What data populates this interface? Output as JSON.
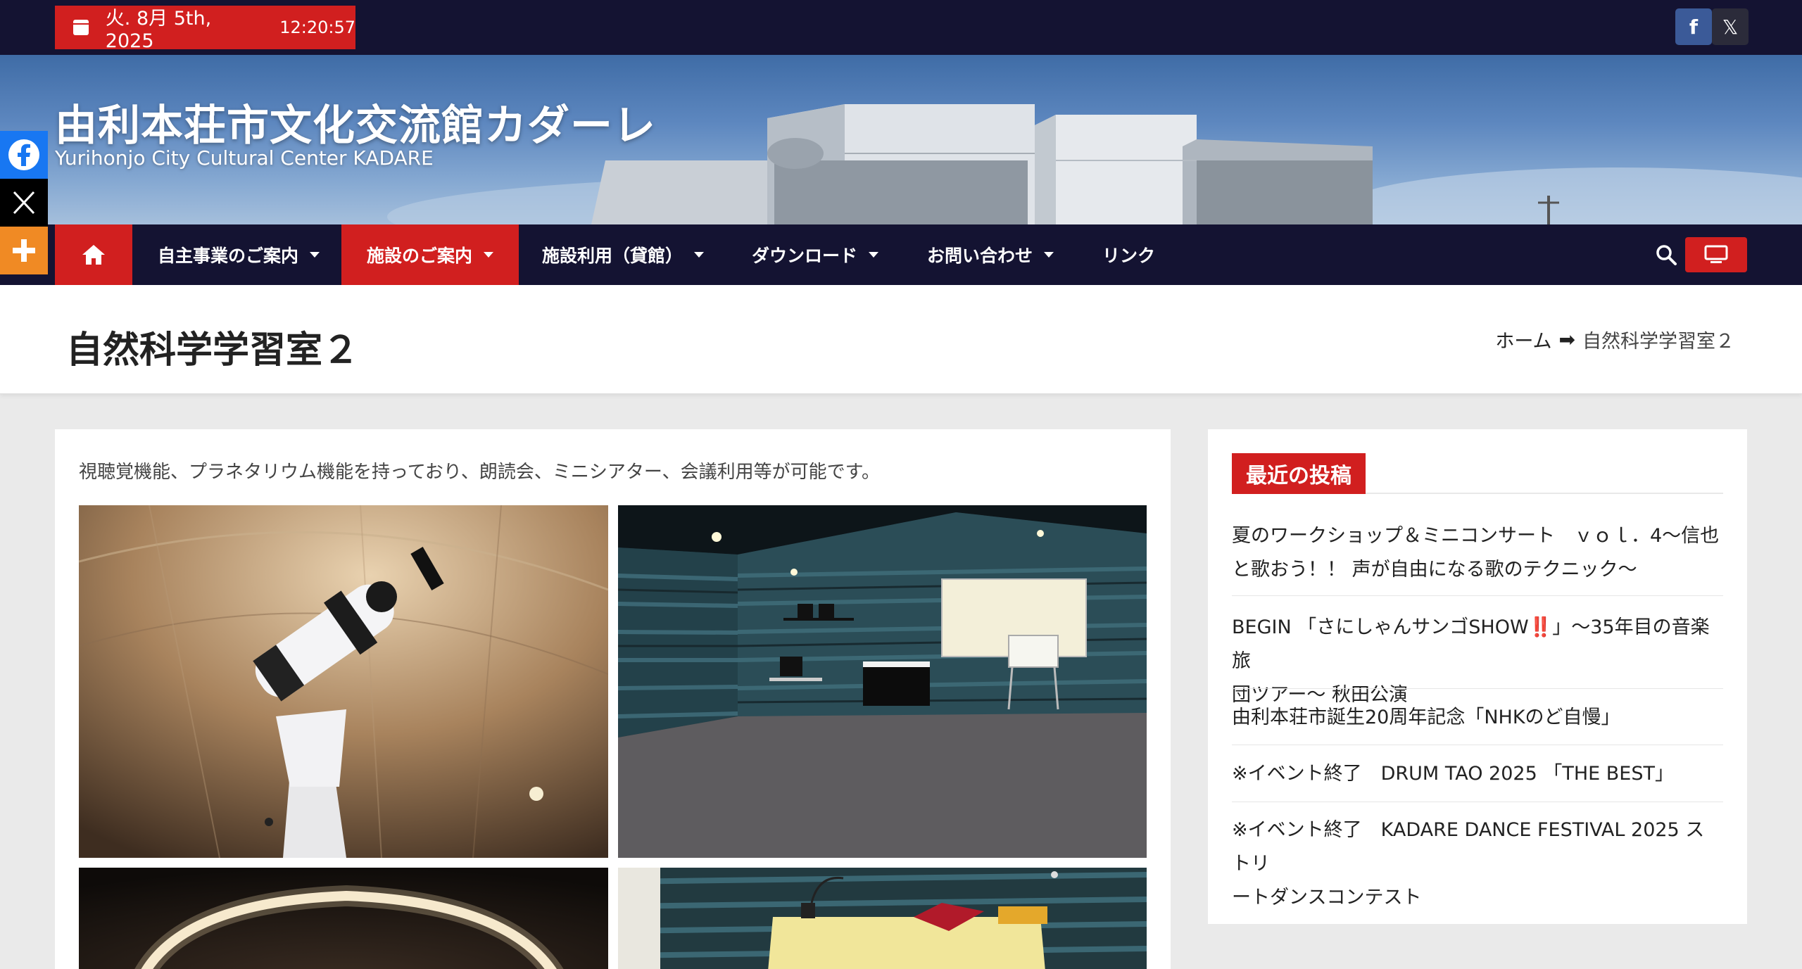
{
  "topbar": {
    "date": "火. 8月 5th, 2025",
    "time": "12:20:57",
    "social": [
      {
        "label": "f",
        "icon": "facebook-icon"
      },
      {
        "label": "𝕏",
        "icon": "x-icon"
      }
    ]
  },
  "header": {
    "title": "由利本荘市文化交流館カダーレ",
    "subtitle": "Yurihonjo City Cultural Center KADARE"
  },
  "nav": {
    "items": [
      {
        "label": "自主事業のご案内",
        "dropdown": true
      },
      {
        "label": "施設のご案内",
        "dropdown": true,
        "active": true
      },
      {
        "label": "施設利用（貸館）",
        "dropdown": true
      },
      {
        "label": "ダウンロード",
        "dropdown": true
      },
      {
        "label": "お問い合わせ",
        "dropdown": true
      },
      {
        "label": "リンク",
        "dropdown": false
      }
    ]
  },
  "share": {
    "items": [
      {
        "icon": "facebook-icon"
      },
      {
        "icon": "x-icon"
      },
      {
        "icon": "plus-icon"
      }
    ]
  },
  "page": {
    "title": "自然科学学習室２",
    "breadcrumb": {
      "home": "ホーム",
      "separator": "➡",
      "current": "自然科学学習室２"
    },
    "intro": "視聴覚機能、プラネタリウム機能を持っており、朗読会、ミニシアター、会議利用等が可能です。"
  },
  "sidebar": {
    "heading": "最近の投稿",
    "posts": [
      {
        "line1": "夏のワークショップ＆ミニコンサート　ｖｏｌ．4〜信也",
        "line2": "と歌おう！！ 声が自由になる歌のテクニック〜"
      },
      {
        "line1": "BEGIN 「さにしゃんサンゴSHOW‼️」〜35年目の音楽旅",
        "line2": "団ツアー〜 秋田公演"
      },
      {
        "line1": "由利本荘市誕生20周年記念「NHKのど自慢」",
        "line2": ""
      },
      {
        "line1": "※イベント終了　DRUM TAO 2025 「THE BEST」",
        "line2": ""
      },
      {
        "line1": "※イベント終了　KADARE DANCE FESTIVAL 2025 ストリ",
        "line2": "ートダンスコンテスト"
      }
    ]
  },
  "colors": {
    "navy": "#141332",
    "accent": "#d11f1f",
    "facebook": "#1877f2",
    "share_plus": "#f08a24"
  }
}
